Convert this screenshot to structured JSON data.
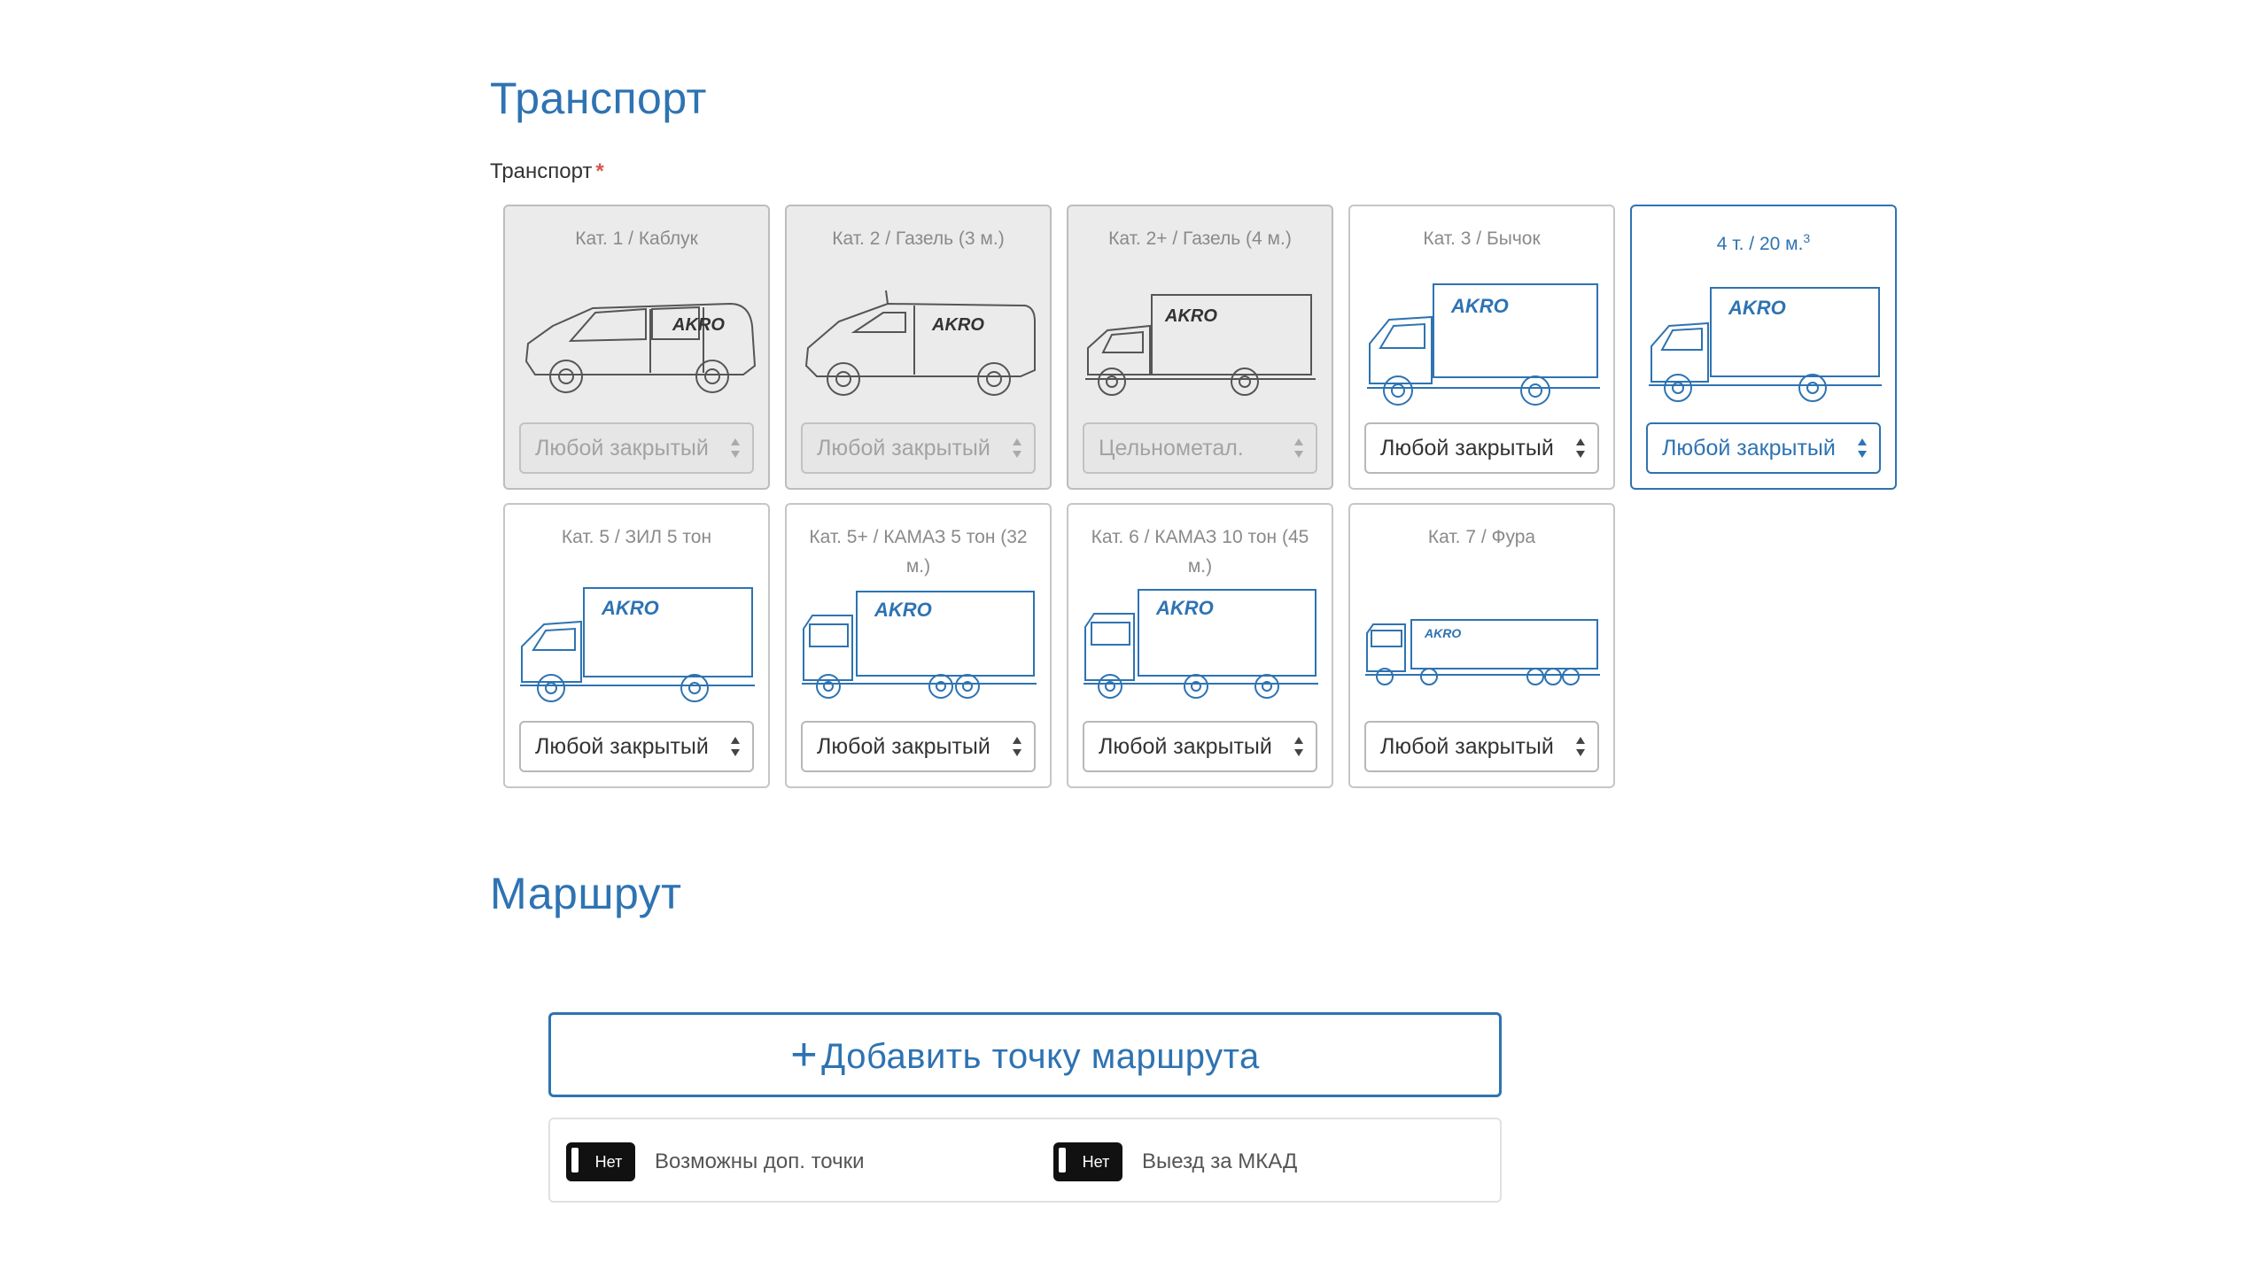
{
  "sections": {
    "transport_title": "Транспорт",
    "route_title": "Маршрут"
  },
  "transport_field": {
    "label": "Транспорт",
    "required_mark": "*"
  },
  "vehicles": [
    {
      "title": "Кат. 1 / Каблук",
      "sup": "",
      "select_value": "Любой закрытый",
      "state": "disabled",
      "icon": "van-small-icon"
    },
    {
      "title": "Кат. 2 / Газель (3 м.)",
      "sup": "",
      "select_value": "Любой закрытый",
      "state": "disabled",
      "icon": "van-icon"
    },
    {
      "title": "Кат. 2+ / Газель (4 м.)",
      "sup": "",
      "select_value": "Цельнометал.",
      "state": "disabled",
      "icon": "light-truck-icon"
    },
    {
      "title": "Кат. 3 / Бычок",
      "sup": "",
      "select_value": "Любой закрытый",
      "state": "enabled",
      "icon": "box-truck-icon"
    },
    {
      "title": "4 т. / 20 м.",
      "sup": "3",
      "select_value": "Любой закрытый",
      "state": "selected",
      "icon": "box-truck-icon"
    },
    {
      "title": "Кат. 5 / ЗИЛ 5 тон",
      "sup": "",
      "select_value": "Любой закрытый",
      "state": "enabled",
      "icon": "box-truck-icon"
    },
    {
      "title": "Кат. 5+ / КАМАЗ 5 тон (32 м.)",
      "sup": "",
      "select_value": "Любой закрытый",
      "state": "enabled",
      "icon": "heavy-truck-icon"
    },
    {
      "title": "Кат. 6 / КАМАЗ 10 тон (45 м.)",
      "sup": "",
      "select_value": "Любой закрытый",
      "state": "enabled",
      "icon": "heavy-truck-icon"
    },
    {
      "title": "Кат. 7 / Фура",
      "sup": "",
      "select_value": "Любой закрытый",
      "state": "enabled",
      "icon": "semi-truck-icon"
    }
  ],
  "route": {
    "add_point_plus": "+",
    "add_point_label": "Добавить точку маршрута",
    "options": [
      {
        "toggle_label": "Нет",
        "label": "Возможны доп. точки"
      },
      {
        "toggle_label": "Нет",
        "label": "Выезд за МКАД"
      }
    ]
  },
  "logo_text": "AKRO",
  "colors": {
    "accent": "#2e73b2",
    "required": "#d9534f",
    "disabled_bg": "#ebebeb",
    "toggle_bg": "#111111"
  }
}
